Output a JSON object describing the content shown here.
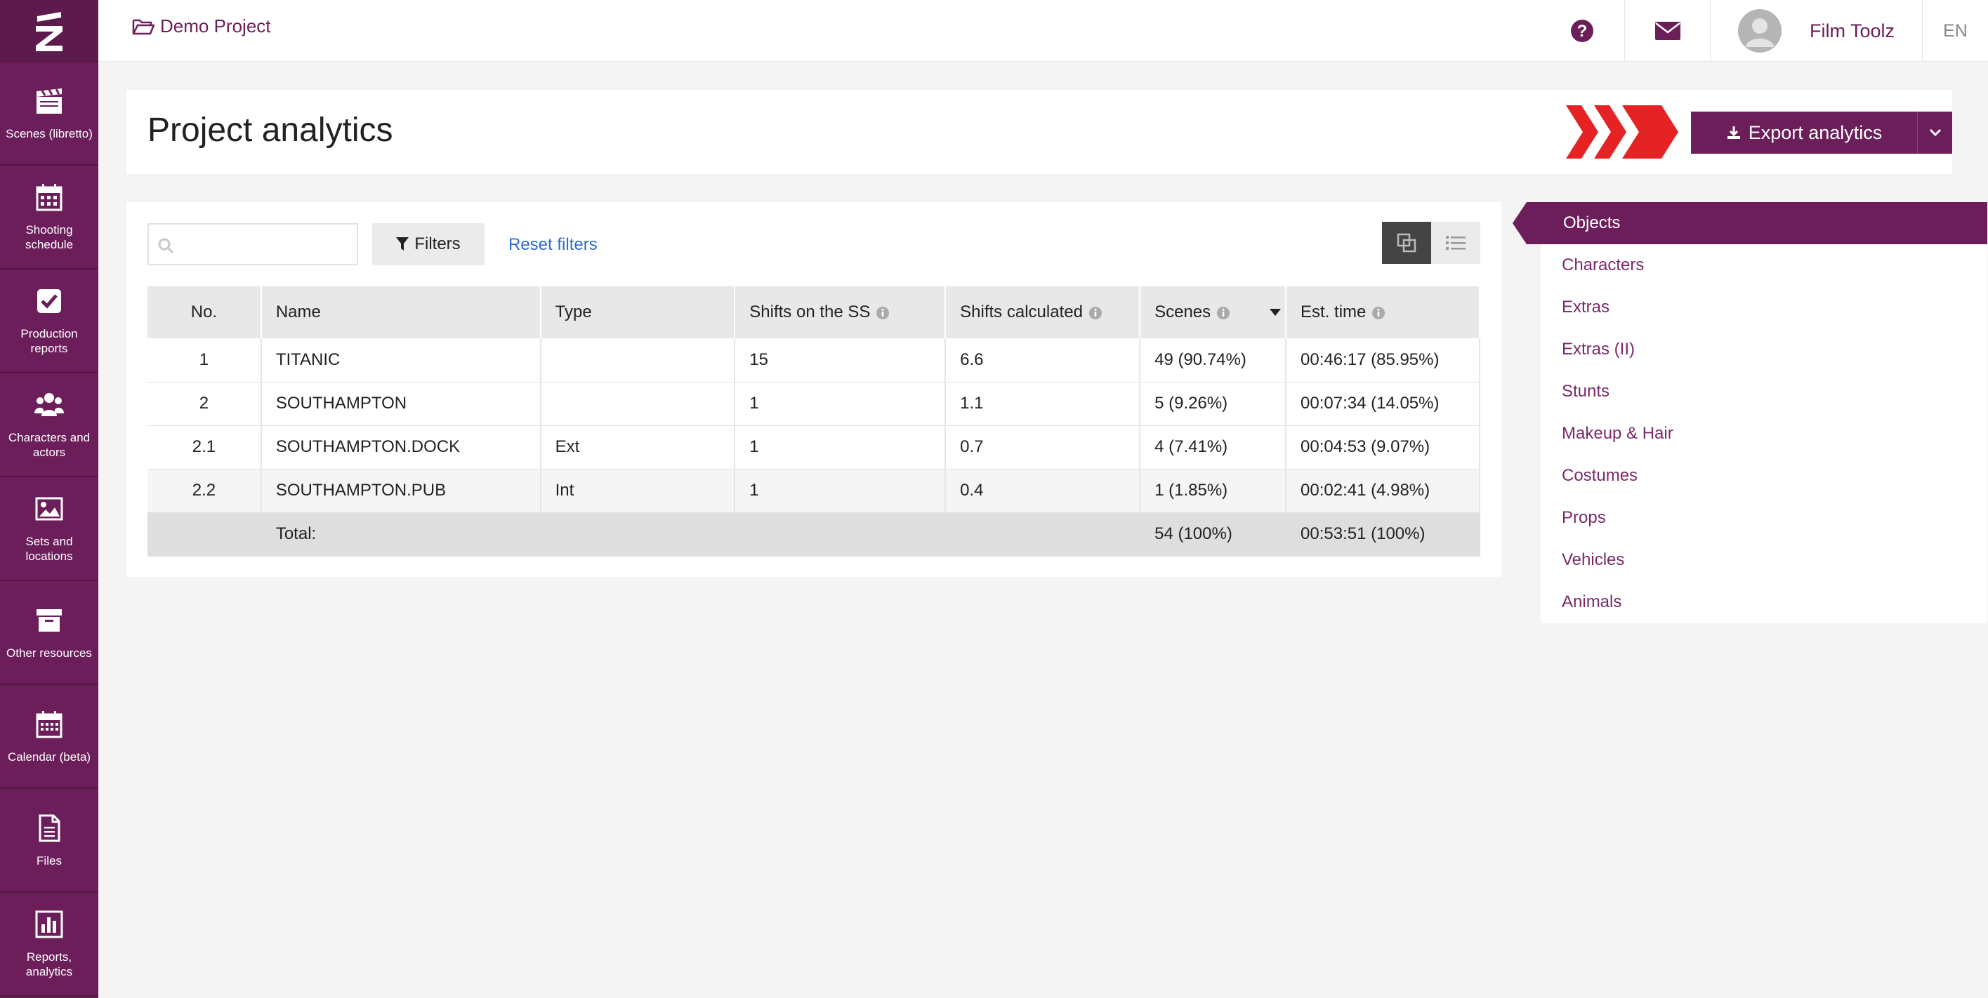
{
  "sidebar": {
    "items": [
      {
        "label": "Scenes (libretto)",
        "icon": "clapperboard-icon"
      },
      {
        "label": "Shooting schedule",
        "icon": "calendar-grid-icon"
      },
      {
        "label": "Production reports",
        "icon": "checkbox-icon"
      },
      {
        "label": "Characters and actors",
        "icon": "users-icon"
      },
      {
        "label": "Sets and locations",
        "icon": "image-icon"
      },
      {
        "label": "Other resources",
        "icon": "archive-icon"
      },
      {
        "label": "Calendar (beta)",
        "icon": "calendar-icon"
      },
      {
        "label": "Files",
        "icon": "file-icon"
      },
      {
        "label": "Reports, analytics",
        "icon": "bar-chart-icon"
      }
    ]
  },
  "topbar": {
    "project_name": "Demo Project",
    "user_name": "Film Toolz",
    "language": "EN"
  },
  "page": {
    "title": "Project analytics",
    "export_label": "Export analytics"
  },
  "toolbar": {
    "search_placeholder": "",
    "filters_label": "Filters",
    "reset_label": "Reset filters"
  },
  "table": {
    "headers": [
      "No.",
      "Name",
      "Type",
      "Shifts on the SS",
      "Shifts calculated",
      "Scenes",
      "Est. time"
    ],
    "rows": [
      {
        "no": "1",
        "name": "TITANIC",
        "type": "",
        "shifts_ss": "15",
        "shifts_calc": "6.6",
        "scenes": "49 (90.74%)",
        "est_time": "00:46:17 (85.95%)"
      },
      {
        "no": "2",
        "name": "SOUTHAMPTON",
        "type": "",
        "shifts_ss": "1",
        "shifts_calc": "1.1",
        "scenes": "5 (9.26%)",
        "est_time": "00:07:34 (14.05%)"
      },
      {
        "no": "2.1",
        "name": "SOUTHAMPTON.DOCK",
        "type": "Ext",
        "shifts_ss": "1",
        "shifts_calc": "0.7",
        "scenes": "4 (7.41%)",
        "est_time": "00:04:53 (9.07%)"
      },
      {
        "no": "2.2",
        "name": "SOUTHAMPTON.PUB",
        "type": "Int",
        "shifts_ss": "1",
        "shifts_calc": "0.4",
        "scenes": "1 (1.85%)",
        "est_time": "00:02:41 (4.98%)"
      }
    ],
    "total": {
      "label": "Total:",
      "scenes": "54 (100%)",
      "est_time": "00:53:51 (100%)"
    }
  },
  "right_menu": {
    "active": "Objects",
    "items": [
      "Characters",
      "Extras",
      "Extras (II)",
      "Stunts",
      "Makeup & Hair",
      "Costumes",
      "Props",
      "Vehicles",
      "Animals"
    ]
  },
  "colors": {
    "brand": "#6b1e5a",
    "accent_red": "#e52325",
    "link_blue": "#2d6ccb"
  }
}
